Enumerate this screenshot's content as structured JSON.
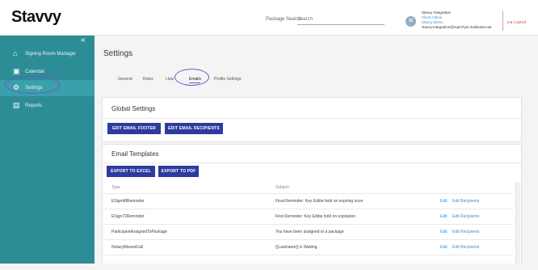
{
  "header": {
    "logo": "Stavvy",
    "search_label": "Package Search -",
    "search_placeholder": "Search",
    "avatar_initials": "SI",
    "user_name": "Stavvy Integration",
    "user_role": "Client Admin",
    "user_org": "Stavvy Demo",
    "user_email": "stavvy-integration@mpm7ym.mailinator.net",
    "logout": "Logout"
  },
  "sidebar": {
    "collapse_glyph": "«",
    "items": [
      {
        "label": "Signing Room Manager",
        "icon": "home-icon"
      },
      {
        "label": "Calendar",
        "icon": "calendar-icon"
      },
      {
        "label": "Settings",
        "icon": "gear-icon"
      },
      {
        "label": "Reports",
        "icon": "reports-icon"
      }
    ]
  },
  "main": {
    "title": "Settings",
    "tabs": [
      "General",
      "Roles",
      "Lists",
      "Emails",
      "Profile Settings"
    ],
    "active_tab": "Emails"
  },
  "global_settings": {
    "title": "Global Settings",
    "buttons": [
      "EDIT EMAIL FOOTER",
      "EDIT EMAIL RECIPIENTS"
    ]
  },
  "email_templates": {
    "title": "Email Templates",
    "buttons": [
      "EXPORT TO EXCEL",
      "EXPORT TO PDF"
    ],
    "columns": [
      "Type",
      "Subject"
    ],
    "rows": [
      {
        "type": "ESign48Reminder",
        "subject": "Final Reminder: Key Eddie hold on expiring soon",
        "edit": "Edit",
        "recipients": "Edit Recipients"
      },
      {
        "type": "ESign72Reminder",
        "subject": "First Reminder: Key Eddie hold on expiration",
        "edit": "Edit",
        "recipients": "Edit Recipients"
      },
      {
        "type": "ParticipantAssignedToPackage",
        "subject": "You have been assigned to a package",
        "edit": "Edit",
        "recipients": "Edit Recipients"
      },
      {
        "type": "NotaryMissedCall",
        "subject": "{{Lastname}} is Waiting",
        "edit": "Edit",
        "recipients": "Edit Recipients"
      }
    ]
  }
}
